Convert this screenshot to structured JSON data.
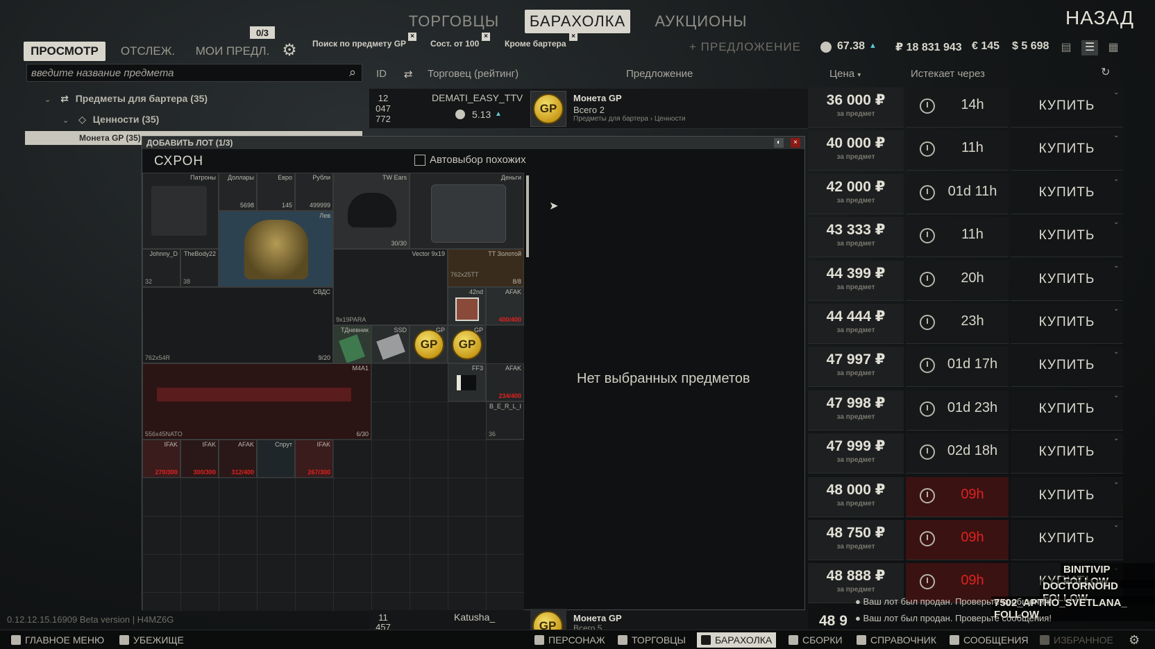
{
  "top_tabs": [
    "ТОРГОВЦЫ",
    "БАРАХОЛКА",
    "АУКЦИОНЫ"
  ],
  "back_label": "НАЗАД",
  "sub_tabs": {
    "browse": "ПРОСМОТР",
    "watch": "ОТСЛЕЖ.",
    "my_offers": "МОИ ПРЕДЛ.",
    "counter": "0/3"
  },
  "filters": [
    "Поиск по предмету GP",
    "Сост. от 100",
    "Кроме бартера"
  ],
  "add_offer": "+ ПРЕДЛОЖЕНИЕ",
  "currency": {
    "rating": "67.38",
    "rub": "₽ 18 831 943",
    "eur": "€ 145",
    "usd": "$ 5 698"
  },
  "search": {
    "placeholder": "введите название предмета"
  },
  "tree": {
    "barter": "Предметы для бартера (35)",
    "valuables": "Ценности (35)",
    "gp": "Монета GP (35)"
  },
  "columns": {
    "id": "ID",
    "trader": "Торговец (рейтинг)",
    "offer": "Предложение",
    "price": "Цена",
    "expires": "Истекает через"
  },
  "first_offer": {
    "id1": "12",
    "id2": "047",
    "id3": "772",
    "trader": "DEMATI_EASY_TTV",
    "rating": "5.13",
    "item": "Монета GP",
    "count": "Всего 2",
    "path": "Предметы для бартера › Ценности"
  },
  "last_offer": {
    "id1": "11",
    "id2": "457",
    "trader": "Katusha_",
    "item": "Монета GP",
    "count": "Всего 5",
    "price": "48 9"
  },
  "offers": [
    {
      "price": "36 000 ₽",
      "expires": "14h",
      "urgent": false
    },
    {
      "price": "40 000 ₽",
      "expires": "11h",
      "urgent": false
    },
    {
      "price": "42 000 ₽",
      "expires": "01d 11h",
      "urgent": false
    },
    {
      "price": "43 333 ₽",
      "expires": "11h",
      "urgent": false
    },
    {
      "price": "44 399 ₽",
      "expires": "20h",
      "urgent": false
    },
    {
      "price": "44 444 ₽",
      "expires": "23h",
      "urgent": false
    },
    {
      "price": "47 997 ₽",
      "expires": "01d 17h",
      "urgent": false
    },
    {
      "price": "47 998 ₽",
      "expires": "01d 23h",
      "urgent": false
    },
    {
      "price": "47 999 ₽",
      "expires": "02d 18h",
      "urgent": false
    },
    {
      "price": "48 000 ₽",
      "expires": "09h",
      "urgent": true
    },
    {
      "price": "48 750 ₽",
      "expires": "09h",
      "urgent": true
    },
    {
      "price": "48 888 ₽",
      "expires": "09h",
      "urgent": true
    }
  ],
  "per_item": "за предмет",
  "buy_label": "КУПИТЬ",
  "dialog": {
    "title": "ДОБАВИТЬ ЛОТ (1/3)",
    "stash": "СХРОН",
    "auto_select": "Автовыбор похожих",
    "empty": "Нет выбранных предметов"
  },
  "stash_items": {
    "ammo": "Патроны",
    "dollars": "Доллары",
    "dollars_cnt": "5698",
    "euro": "Евро",
    "euro_cnt": "145",
    "rub": "Рубли",
    "rub_cnt": "499999",
    "money": "Деньги",
    "tw_ears": "TW Ears",
    "tw_ears_cnt": "30/30",
    "lion": "Лев",
    "johnny": "Johnny_D",
    "johnny_cnt": "32",
    "thebody": "TheBody22",
    "thebody_cnt": "38",
    "vector": "Vector 9x19",
    "tt": "TT Золотой",
    "tt_ammo": "762x25TT",
    "tt_cnt": "8/8",
    "svd": "СВДС",
    "svd_ammo": "762x54R",
    "svd_cnt": "9/20",
    "para": "9x19PARA",
    "poster": "42nd",
    "afak": "AFAK",
    "afak_cnt": "400/400",
    "diary": "ТДневник",
    "ssd": "SSD",
    "gp": "GP",
    "m4a1": "M4A1",
    "m4_ammo": "556x45NATO",
    "m4_cnt": "6/30",
    "ff3": "FF3",
    "afak2": "AFAK",
    "afak2_cnt": "234/400",
    "berl": "B_E_R_L_I",
    "berl_cnt": "36",
    "ifak1": "IFAK",
    "ifak1_cnt": "270/300",
    "ifak2": "IFAK",
    "ifak2_cnt": "300/300",
    "afak3": "AFAK",
    "afak3_cnt": "312/400",
    "sprut": "Спрут",
    "ifak3": "IFAK",
    "ifak3_cnt": "267/300"
  },
  "version": "0.12.12.15.16909 Beta version | H4MZ6G",
  "bottom_nav": [
    "ГЛАВНОЕ МЕНЮ",
    "УБЕЖИЩЕ",
    "ПЕРСОНАЖ",
    "ТОРГОВЦЫ",
    "БАРАХОЛКА",
    "СБОРКИ",
    "СПРАВОЧНИК",
    "СООБЩЕНИЯ",
    "ИЗБРАННОЕ"
  ],
  "notifications": [
    "Ваш лот был продан. Проверьте сообщения!",
    "Ваш лот был продан. Проверьте сообщения!"
  ],
  "stream_follows": [
    "BINITIVIP  FOLLOW",
    "DOCTORNOHD  FOLLOW",
    "7502_APTHO_SVETLANA_  FOLLOW"
  ]
}
